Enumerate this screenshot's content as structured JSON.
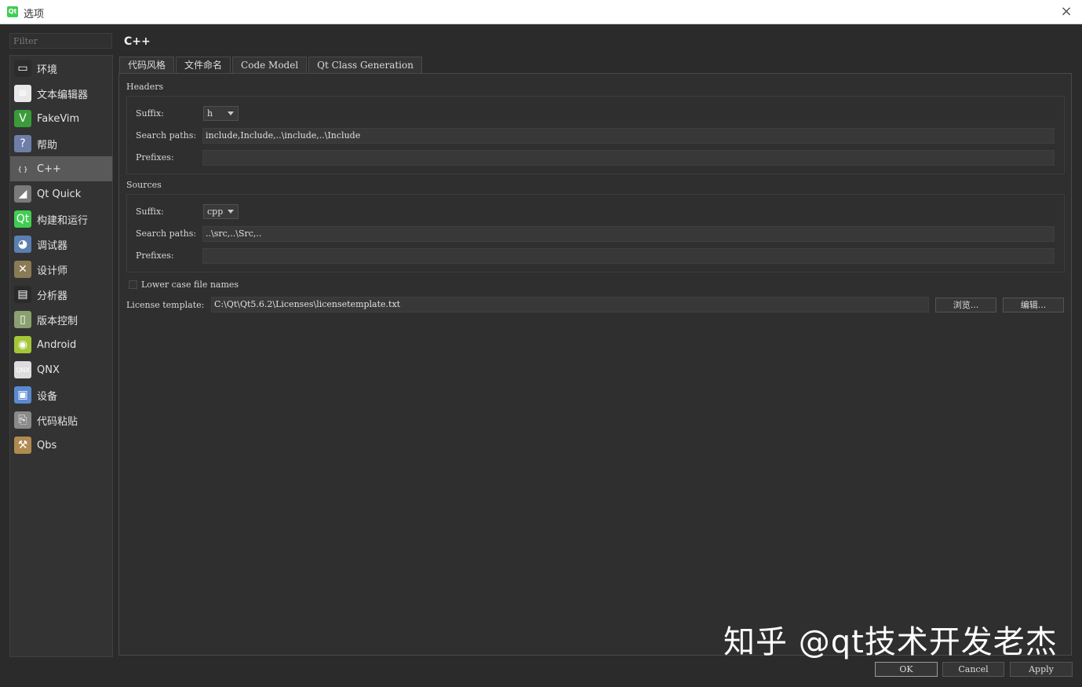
{
  "window": {
    "title": "选项",
    "app_icon": "Qt",
    "close": "×"
  },
  "filter": {
    "placeholder": "Filter"
  },
  "sidebar": {
    "items": [
      {
        "label": "环境",
        "icon": "monitor-icon",
        "glyph": "▭",
        "color": "#2c2c2c"
      },
      {
        "label": "文本编辑器",
        "icon": "text-editor-icon",
        "glyph": "≡",
        "color": "#e8e8e8"
      },
      {
        "label": "FakeVim",
        "icon": "fakevim-icon",
        "glyph": "V",
        "color": "#3a9b3a"
      },
      {
        "label": "帮助",
        "icon": "help-icon",
        "glyph": "?",
        "color": "#6f7ea8"
      },
      {
        "label": "C++",
        "icon": "braces-icon",
        "glyph": "{ }",
        "color": "#595959"
      },
      {
        "label": "Qt Quick",
        "icon": "paper-plane-icon",
        "glyph": "◢",
        "color": "#7a7a7a"
      },
      {
        "label": "构建和运行",
        "icon": "build-run-icon",
        "glyph": "Qt",
        "color": "#41cd52"
      },
      {
        "label": "调试器",
        "icon": "debugger-icon",
        "glyph": "◕",
        "color": "#5a7fb0"
      },
      {
        "label": "设计师",
        "icon": "designer-tools-icon",
        "glyph": "✕",
        "color": "#8a7a55"
      },
      {
        "label": "分析器",
        "icon": "analyzer-icon",
        "glyph": "▤",
        "color": "#2a2a2a"
      },
      {
        "label": "版本控制",
        "icon": "version-control-icon",
        "glyph": "▯",
        "color": "#8aa070"
      },
      {
        "label": "Android",
        "icon": "android-icon",
        "glyph": "◉",
        "color": "#a4c639"
      },
      {
        "label": "QNX",
        "icon": "qnx-icon",
        "glyph": "QNX",
        "color": "#dddddd"
      },
      {
        "label": "设备",
        "icon": "device-icon",
        "glyph": "▣",
        "color": "#5a8ad0"
      },
      {
        "label": "代码粘贴",
        "icon": "code-paste-icon",
        "glyph": "⎘",
        "color": "#8a8a8a"
      },
      {
        "label": "Qbs",
        "icon": "hammer-icon",
        "glyph": "⚒",
        "color": "#b08a50"
      }
    ],
    "selected": "C++"
  },
  "page": {
    "title": "C++"
  },
  "tabs": [
    {
      "label": "代码风格"
    },
    {
      "label": "文件命名"
    },
    {
      "label": "Code Model"
    },
    {
      "label": "Qt Class Generation"
    }
  ],
  "active_tab": "文件命名",
  "headers": {
    "title": "Headers",
    "suffix_label": "Suffix:",
    "suffix_value": "h",
    "search_label": "Search paths:",
    "search_value": "include,Include,..\\include,..\\Include",
    "prefixes_label": "Prefixes:",
    "prefixes_value": ""
  },
  "sources": {
    "title": "Sources",
    "suffix_label": "Suffix:",
    "suffix_value": "cpp",
    "search_label": "Search paths:",
    "search_value": "..\\src,..\\Src,..",
    "prefixes_label": "Prefixes:",
    "prefixes_value": ""
  },
  "lower_case": {
    "label": "Lower case file names",
    "checked": false
  },
  "license": {
    "label": "License template:",
    "value": "C:\\Qt\\Qt5.6.2\\Licenses\\licensetemplate.txt",
    "browse_label": "浏览...",
    "edit_label": "编辑..."
  },
  "buttons": {
    "ok": "OK",
    "cancel": "Cancel",
    "apply": "Apply"
  },
  "watermark": "知乎 @qt技术开发老杰"
}
